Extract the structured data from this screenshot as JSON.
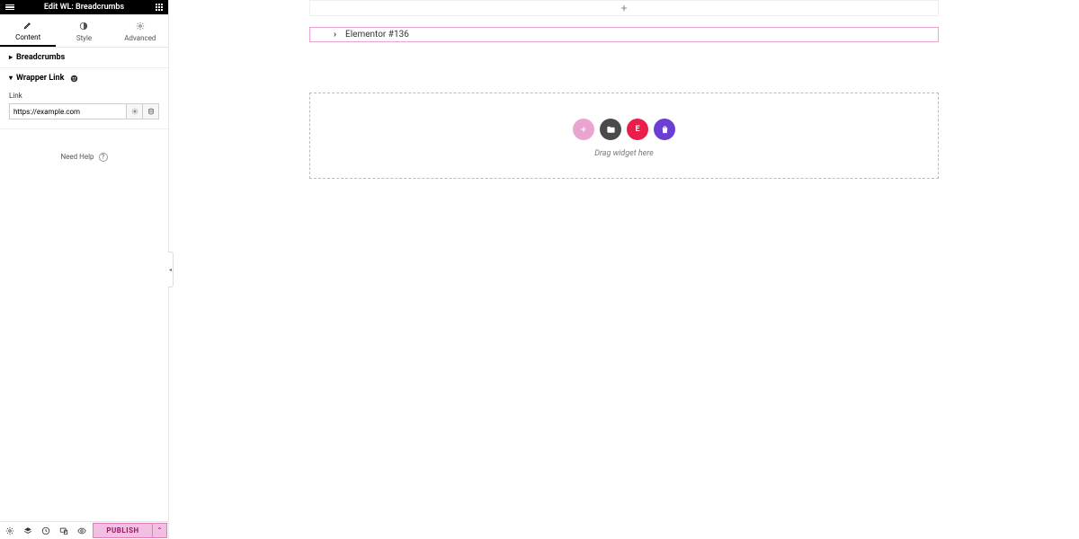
{
  "header": {
    "title": "Edit WL: Breadcrumbs"
  },
  "tabs": {
    "content": "Content",
    "style": "Style",
    "advanced": "Advanced"
  },
  "sections": {
    "breadcrumbs": {
      "title": "Breadcrumbs"
    },
    "wrapper": {
      "title": "Wrapper Link",
      "link_label": "Link",
      "link_value": "https://example.com"
    }
  },
  "help": {
    "label": "Need Help"
  },
  "footer": {
    "publish": "PUBLISH"
  },
  "canvas": {
    "breadcrumb_text": "Elementor #136",
    "dropzone_text": "Drag widget here"
  }
}
